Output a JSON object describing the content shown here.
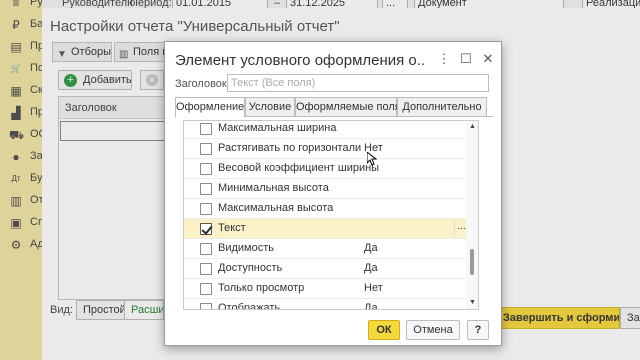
{
  "sidebar": {
    "items": [
      {
        "icon": "menu-icon",
        "glyph": "≡",
        "label": "Руководителю"
      },
      {
        "icon": "ruble-icon",
        "glyph": "₽",
        "label": "Банк и касса"
      },
      {
        "icon": "document-icon",
        "glyph": "▤",
        "label": "Продажи"
      },
      {
        "icon": "cart-icon",
        "glyph": "🛒",
        "label": "Покупки"
      },
      {
        "icon": "warehouse-icon",
        "glyph": "▦",
        "label": "Склад"
      },
      {
        "icon": "factory-icon",
        "glyph": "▟",
        "label": "Производство"
      },
      {
        "icon": "truck-icon",
        "glyph": "⛟",
        "label": "ОС и НМА"
      },
      {
        "icon": "person-icon",
        "glyph": "●",
        "label": "Зарплата и кадры"
      },
      {
        "icon": "ledger-icon",
        "glyph": "Дт",
        "label": "Бухгалтерия"
      },
      {
        "icon": "chart-icon",
        "glyph": "▥",
        "label": "Отчеты"
      },
      {
        "icon": "books-icon",
        "glyph": "▣",
        "label": "Справочники"
      },
      {
        "icon": "gear-icon",
        "glyph": "⚙",
        "label": "Администрирование"
      }
    ]
  },
  "topbar": {
    "label": "Руководителю",
    "period_label": "Период:",
    "date_from": "01.01.2015",
    "dash": "–",
    "date_to": "31.12.2025",
    "ellipsis": "...",
    "doc_field": "Документ",
    "realization": "Реализация"
  },
  "bg_window": {
    "title": "Настройки отчета \"Универсальный отчет\"",
    "tabs": [
      "Отборы",
      "Поля и сортировки"
    ],
    "add_label": "Добавить",
    "column_header": "Заголовок",
    "view_label": "Вид:",
    "view_simple": "Простой",
    "view_extended": "Расширенный",
    "form_button": "Завершить и сформировать",
    "close_button": "Закрыть"
  },
  "dialog": {
    "title": "Элемент условного оформления о...",
    "header_label": "Заголовок:",
    "header_placeholder": "Текст (Все поля)",
    "tabs": [
      "Оформление",
      "Условие",
      "Оформляемые поля",
      "Дополнительно"
    ],
    "properties": [
      {
        "name": "Максимальная ширина",
        "value": "",
        "checked": false
      },
      {
        "name": "Растягивать по горизонтали",
        "value": "Нет",
        "checked": false
      },
      {
        "name": "Весовой коэффициент ширины",
        "value": "",
        "checked": false
      },
      {
        "name": "Минимальная высота",
        "value": "",
        "checked": false
      },
      {
        "name": "Максимальная высота",
        "value": "",
        "checked": false
      },
      {
        "name": "Текст",
        "value": "",
        "checked": true
      },
      {
        "name": "Видимость",
        "value": "Да",
        "checked": false
      },
      {
        "name": "Доступность",
        "value": "Да",
        "checked": false
      },
      {
        "name": "Только просмотр",
        "value": "Нет",
        "checked": false
      },
      {
        "name": "Отображать",
        "value": "Да",
        "checked": false
      }
    ],
    "row_button": "...",
    "ok": "ОК",
    "cancel": "Отмена",
    "help": "?"
  }
}
